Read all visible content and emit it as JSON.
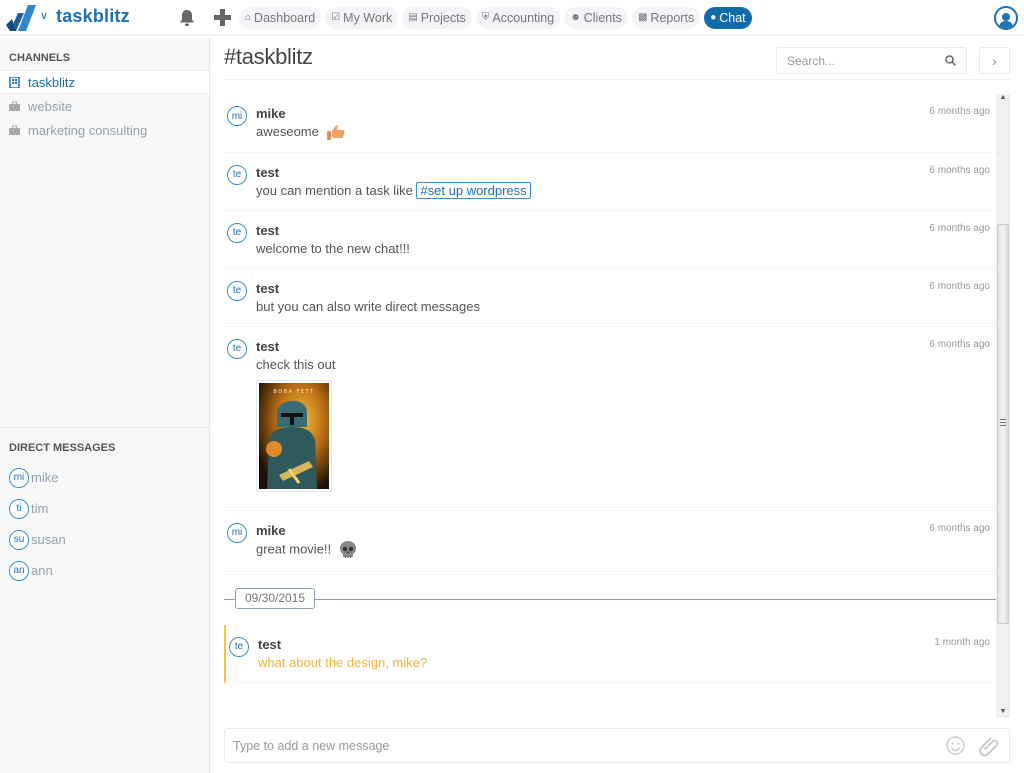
{
  "app": {
    "brand": "taskblitz"
  },
  "nav": {
    "items": [
      {
        "label": "Dashboard",
        "icon": "home-icon"
      },
      {
        "label": "My Work",
        "icon": "checkbox-icon"
      },
      {
        "label": "Projects",
        "icon": "briefcase-icon"
      },
      {
        "label": "Accounting",
        "icon": "shield-icon"
      },
      {
        "label": "Clients",
        "icon": "users-icon"
      },
      {
        "label": "Reports",
        "icon": "bar-chart-icon"
      },
      {
        "label": "Chat",
        "icon": "chat-icon",
        "active": true
      }
    ]
  },
  "sidebar": {
    "channels_heading": "CHANNELS",
    "channels": [
      {
        "label": "taskblitz",
        "icon": "building-icon",
        "active": true
      },
      {
        "label": "website",
        "icon": "briefcase-icon"
      },
      {
        "label": "marketing consulting",
        "icon": "briefcase-icon"
      }
    ],
    "dm_heading": "DIRECT MESSAGES",
    "direct_messages": [
      {
        "initials": "mi",
        "name": "mike"
      },
      {
        "initials": "ti",
        "name": "tim"
      },
      {
        "initials": "su",
        "name": "susan"
      },
      {
        "initials": "an",
        "name": "ann"
      }
    ]
  },
  "main": {
    "channel_title": "#taskblitz",
    "search_placeholder": "Search...",
    "messages": [
      {
        "initials": "mi",
        "author": "mike",
        "text": "aweseome",
        "time": "6 months ago",
        "emoji": "thumbs-up"
      },
      {
        "initials": "te",
        "author": "test",
        "text": "you can mention a task like",
        "mention": "#set up wordpress",
        "time": "6 months ago"
      },
      {
        "initials": "te",
        "author": "test",
        "text": "welcome to the new chat!!!",
        "time": "6 months ago"
      },
      {
        "initials": "te",
        "author": "test",
        "text": "but you can also write direct messages",
        "time": "6 months ago"
      },
      {
        "initials": "te",
        "author": "test",
        "text": "check this out",
        "time": "6 months ago",
        "attachment": "BOBA FETT"
      },
      {
        "initials": "mi",
        "author": "mike",
        "text": "great movie!!",
        "time": "6 months ago",
        "emoji": "skull"
      }
    ],
    "date_separator": "09/30/2015",
    "new_messages": [
      {
        "initials": "te",
        "author": "test",
        "text": "what about the design, mike?",
        "time": "1 month ago",
        "highlight": true
      }
    ],
    "composer_placeholder": "Type to add a new message"
  },
  "colors": {
    "brand": "#1f6fb5",
    "active_nav": "#136aab",
    "highlight": "#f4b43a"
  }
}
